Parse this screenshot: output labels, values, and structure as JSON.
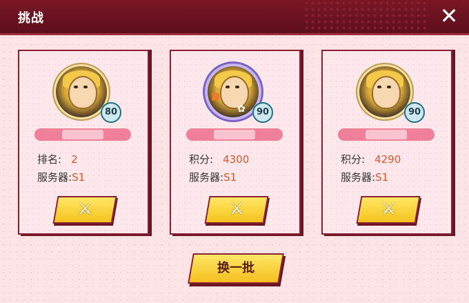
{
  "window": {
    "title": "挑战"
  },
  "cards": [
    {
      "level": "80",
      "stat_label": "排名:",
      "stat_value": "2",
      "server_label": "服务器:",
      "server_value": "S1"
    },
    {
      "level": "90",
      "stat_label": "积分:",
      "stat_value": "4300",
      "server_label": "服务器:",
      "server_value": "S1"
    },
    {
      "level": "90",
      "stat_label": "积分:",
      "stat_value": "4290",
      "server_label": "服务器:",
      "server_value": "S1"
    }
  ],
  "refresh_label": "换一批",
  "icons": {
    "close": "close-icon",
    "fight": "crossed-swords-icon"
  },
  "colors": {
    "title_bar": "#6a1222",
    "accent_value": "#e2552a",
    "button": "#f5c21d"
  }
}
